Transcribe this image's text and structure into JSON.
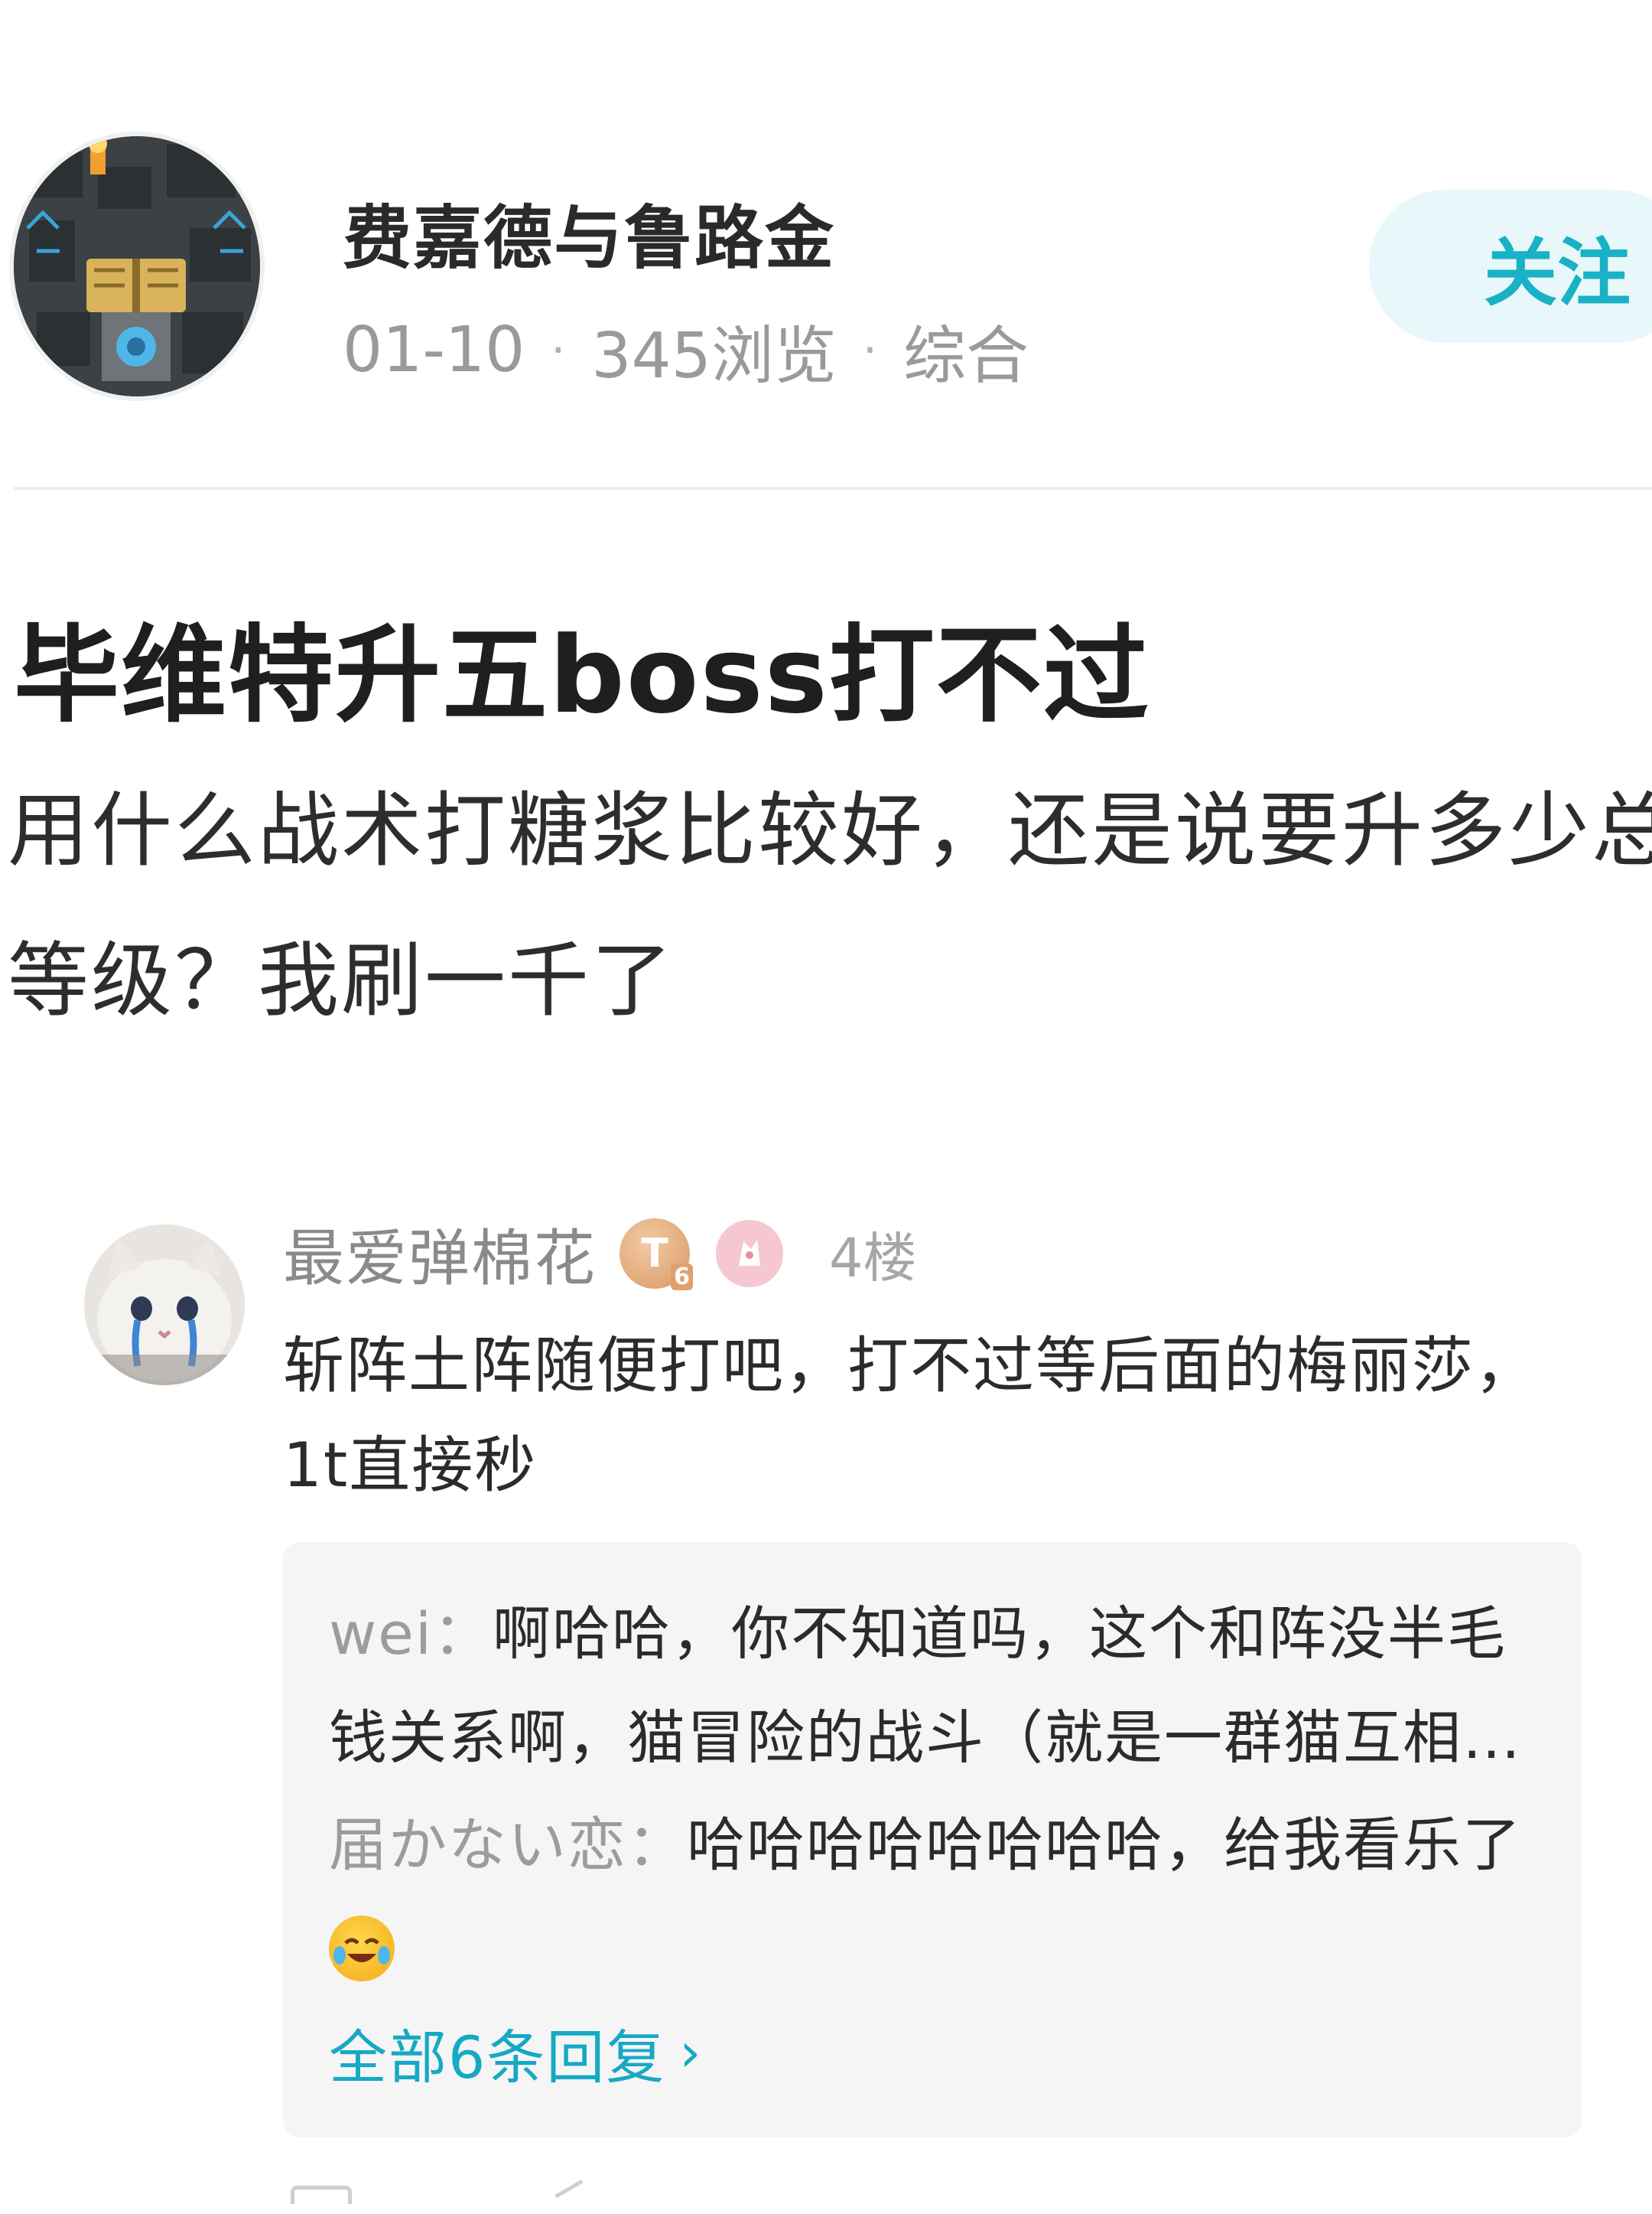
{
  "author": {
    "name": "费嘉德与鲁路金",
    "date": "01-10",
    "views": "345浏览",
    "category": "综合",
    "follow_label": "关注"
  },
  "post": {
    "title": "毕维特升五boss打不过",
    "body_line1": "用什么战术打糖浆比较好，还是说要升多少总",
    "body_line2": "等级？我刷一千了"
  },
  "comment": {
    "username": "最爱弹棉花",
    "level_badge": "T",
    "level_number": "6",
    "floor": "4楼",
    "text": "斩阵土阵随便打吧，打不过等后面的梅丽莎，1t直接秒",
    "replies": [
      {
        "user": "wei",
        "text": "啊哈哈，你不知道吗，这个和阵没半毛钱关系啊，猫冒险的战斗（就是一群猫互相殴打，只有数值有用"
      },
      {
        "user": "届かない恋",
        "text": "哈哈哈哈哈哈哈哈，给我看乐了"
      }
    ],
    "view_all_label": "全部6条回复",
    "view_all_chevron": "›"
  },
  "colors": {
    "accent": "#19b1c6",
    "follow_bg": "#e8f7f9",
    "reply_bg": "#f5f5f5",
    "muted_text": "#9a9a9a"
  }
}
